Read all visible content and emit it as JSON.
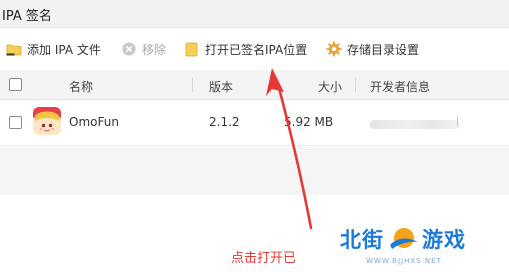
{
  "window": {
    "title": "IPA 签名"
  },
  "toolbar": {
    "add_label": "添加 IPA 文件",
    "remove_label": "移除",
    "open_signed_label": "打开已签名IPA位置",
    "storage_settings_label": "存储目录设置"
  },
  "table": {
    "columns": {
      "name": "名称",
      "version": "版本",
      "size": "大小",
      "developer": "开发者信息"
    },
    "rows": [
      {
        "name": "OmoFun",
        "version": "2.1.2",
        "size": "5.92 MB",
        "developer": ""
      }
    ]
  },
  "annotation": {
    "caption": "点击打开已",
    "arrow_color": "#e53935"
  },
  "watermark": {
    "part1": "北街",
    "part2": "游戏",
    "url": "WWW.BJJHXS.NET"
  },
  "colors": {
    "accent": "#e53935",
    "watermark": "#1d7ad6",
    "folder": "#f6cf57",
    "gear": "#e8a640"
  },
  "icons": {
    "add": "folder-plus-icon",
    "remove": "remove-circle-icon",
    "open": "folder-icon",
    "settings": "gear-icon",
    "app": "omofun-app-icon"
  }
}
